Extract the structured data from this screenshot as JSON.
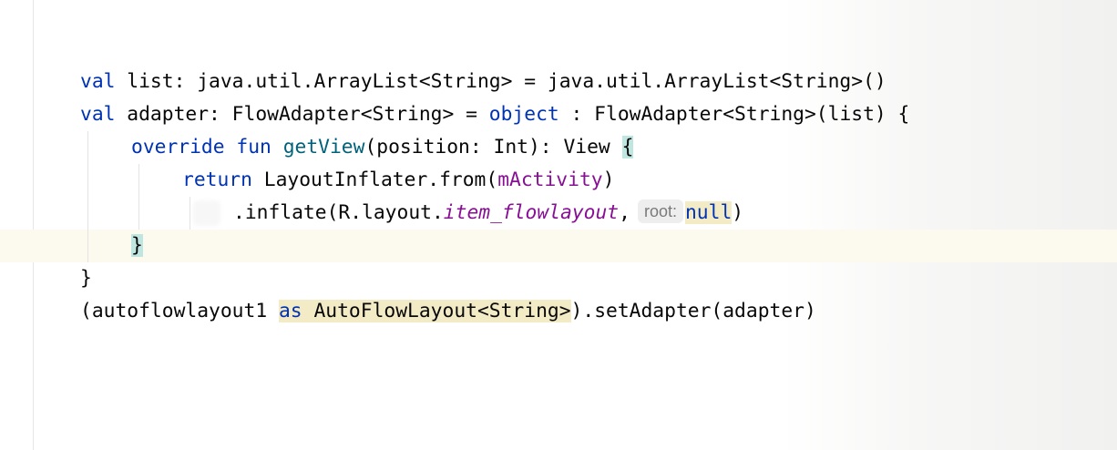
{
  "editor": {
    "lines": [
      {
        "id": "line-1",
        "tokens": [
          {
            "text": "val",
            "cls": "kw"
          },
          {
            "text": " list: java.util.ArrayList<String> = java.util.ArrayList<String>()"
          }
        ]
      },
      {
        "id": "line-2",
        "tokens": [
          {
            "text": "val",
            "cls": "kw"
          },
          {
            "text": " adapter: FlowAdapter<String> = "
          },
          {
            "text": "object",
            "cls": "kw"
          },
          {
            "text": " : FlowAdapter<String>(list) {"
          }
        ]
      },
      {
        "id": "line-3",
        "indent": 1,
        "tokens": [
          {
            "text": "override",
            "cls": "kw"
          },
          {
            "text": " "
          },
          {
            "text": "fun",
            "cls": "kw"
          },
          {
            "text": " "
          },
          {
            "text": "getView",
            "cls": "fn"
          },
          {
            "text": "(position: Int): View "
          },
          {
            "text": "{",
            "cls": "brace-match"
          }
        ]
      },
      {
        "id": "line-4",
        "indent": 2,
        "tokens": [
          {
            "text": "return",
            "cls": "kw"
          },
          {
            "text": " LayoutInflater.from("
          },
          {
            "text": "mActivity",
            "cls": "fld"
          },
          {
            "text": ")"
          }
        ]
      },
      {
        "id": "line-5",
        "indent": 3,
        "tokens": [
          {
            "text": ".inflate(R.layout."
          },
          {
            "text": "item_flowlayout",
            "cls": "fld it"
          },
          {
            "text": ","
          },
          {
            "text": "root:",
            "cls": "hint"
          },
          {
            "text": "null",
            "cls": "kw usage"
          },
          {
            "text": ")"
          }
        ]
      },
      {
        "id": "line-6",
        "indent": 1,
        "tokens": [
          {
            "text": "}",
            "cls": "brace-match"
          }
        ]
      },
      {
        "id": "line-7",
        "tokens": [
          {
            "text": "}"
          }
        ]
      },
      {
        "id": "line-8",
        "tokens": [
          {
            "text": "(autoflowlayout1 "
          },
          {
            "text": "as",
            "cls": "kw usage"
          },
          {
            "text": " AutoFlowLayout<String>",
            "cls": "usage"
          },
          {
            "text": ").setAdapter(adapter)"
          }
        ]
      }
    ]
  },
  "colors": {
    "keyword": "#0033b3",
    "function": "#00627a",
    "field": "#871094",
    "brace_match": "#bfe6e0",
    "usage_highlight": "#f3ebc6",
    "caret_row": "#fcfaed"
  }
}
